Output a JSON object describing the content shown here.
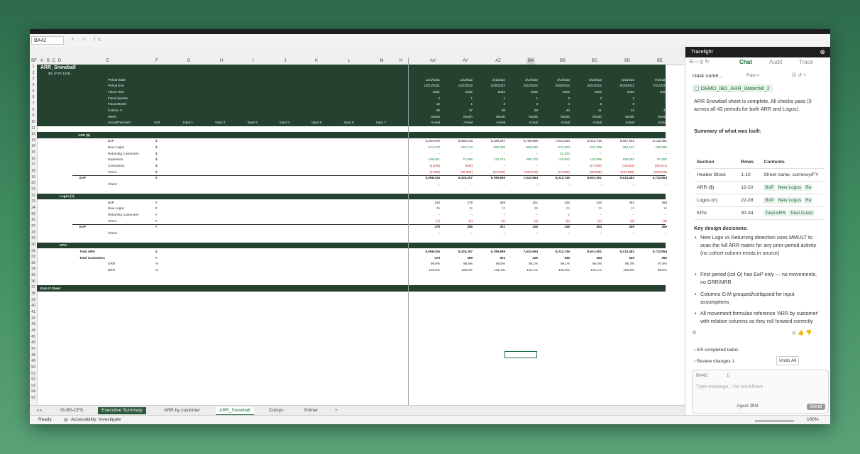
{
  "formula_bar": {
    "name_box": "BA42",
    "fx": "× ✓ fx"
  },
  "sheet": {
    "title": "ARR_Snowball",
    "subtitle": "$m | FYE 12/31",
    "columns": [
      "A",
      "B",
      "C",
      "D",
      "E",
      "F",
      "G",
      "H",
      "I",
      "J",
      "K",
      "L",
      "M",
      "N",
      "AX",
      "AY",
      "AZ",
      "BA",
      "BB",
      "BC",
      "BD",
      "BE",
      "BF"
    ],
    "header_labels": [
      "Period Start",
      "Period End",
      "Fiscal Year",
      "Fiscal Quarter",
      "Fiscal Month",
      "Column #",
      "Metric",
      "Actual/Forecast"
    ],
    "unit_header": "Unit",
    "inputs": [
      "Input 1",
      "Input 2",
      "Input 3",
      "Input 4",
      "Input 5",
      "Input 6",
      "Input 7"
    ],
    "periods": [
      {
        "start": "12/1/2021",
        "end": "12/31/2021",
        "fy": "2021",
        "fq": "4",
        "fm": "12",
        "col": "36",
        "metric": "Month",
        "af": "Actual"
      },
      {
        "start": "1/1/2022",
        "end": "1/31/2022",
        "fy": "2022",
        "fq": "1",
        "fm": "1",
        "col": "37",
        "metric": "Month",
        "af": "Actual"
      },
      {
        "start": "2/1/2022",
        "end": "2/28/2022",
        "fy": "2022",
        "fq": "1",
        "fm": "2",
        "col": "38",
        "metric": "Month",
        "af": "Actual"
      },
      {
        "start": "3/1/2022",
        "end": "3/31/2022",
        "fy": "2022",
        "fq": "1",
        "fm": "3",
        "col": "39",
        "metric": "Month",
        "af": "Actual"
      },
      {
        "start": "4/1/2022",
        "end": "4/30/2022",
        "fy": "2022",
        "fq": "2",
        "fm": "4",
        "col": "40",
        "metric": "Month",
        "af": "Actual"
      },
      {
        "start": "5/1/2022",
        "end": "5/31/2022",
        "fy": "2022",
        "fq": "2",
        "fm": "5",
        "col": "41",
        "metric": "Month",
        "af": "Actual"
      },
      {
        "start": "6/1/2022",
        "end": "6/30/2022",
        "fy": "2022",
        "fq": "2",
        "fm": "6",
        "col": "42",
        "metric": "Month",
        "af": "Actual"
      },
      {
        "start": "7/1/2022",
        "end": "7/31/2022",
        "fy": "2022",
        "fq": "3",
        "fm": "7",
        "col": "43",
        "metric": "Month",
        "af": "Actual"
      }
    ],
    "sections": {
      "arr": {
        "title": "ARR ($)",
        "rows": [
          {
            "label": "BoP",
            "unit": "$",
            "vals": [
              "5,264,676",
              "6,098,016",
              "6,329,297",
              "6,789,889",
              "7,543,664",
              "8,313,746",
              "8,647,601",
              "9,133,481"
            ],
            "cls": "d"
          },
          {
            "label": "New Logos",
            "unit": "$",
            "vals": [
              "674,473",
              "225,743",
              "380,330",
              "808,042",
              "674,254",
              "245,788",
              "459,187",
              "708,088"
            ],
            "cls": "g"
          },
          {
            "label": "Returning Customers",
            "unit": "$",
            "vals": [
              "–",
              "–",
              "–",
              "–",
              "23,200",
              "–",
              "–",
              "–"
            ],
            "cls": "g"
          },
          {
            "label": "Expansion",
            "unit": "$",
            "vals": [
              "169,821",
              "70,668",
              "113,742",
              "285,723",
              "149,837",
              "128,096",
              "189,802",
              "87,605"
            ],
            "cls": "g"
          },
          {
            "label": "Contraction",
            "unit": "$",
            "vals": [
              "(4,846)",
              "(608)",
              "–",
              "–",
              "–",
              "(17,089)",
              "(18,619)",
              "(65,021)"
            ],
            "cls": "r"
          },
          {
            "label": "Churn",
            "unit": "$",
            "vals": [
              "(6,488)",
              "(65,082)",
              "(33,500)",
              "(133,540)",
              "(73,289)",
              "(28,508)",
              "(132,898)",
              "(130,549)"
            ],
            "cls": "r"
          },
          {
            "label": "EoP",
            "unit": "$",
            "vals": [
              "6,098,016",
              "6,329,297",
              "6,789,889",
              "7,543,664",
              "8,313,746",
              "8,647,601",
              "9,133,481",
              "9,733,654"
            ],
            "cls": "d",
            "bold": true
          },
          {
            "label": "Check",
            "unit": "",
            "vals": [
              "–",
              "–",
              "–",
              "–",
              "–",
              "–",
              "–",
              "–"
            ],
            "cls": "d"
          }
        ]
      },
      "logos": {
        "title": "Logos (#)",
        "rows": [
          {
            "label": "BoP",
            "unit": "#",
            "vals": [
              "244",
              "279",
              "289",
              "301",
              "326",
              "345",
              "354",
              "359"
            ],
            "cls": "d"
          },
          {
            "label": "New Logos",
            "unit": "#",
            "vals": [
              "36",
              "16",
              "13",
              "28",
              "24",
              "13",
              "13",
              "16"
            ],
            "cls": "g"
          },
          {
            "label": "Returning Customers",
            "unit": "#",
            "vals": [
              "–",
              "–",
              "–",
              "–",
              "1",
              "–",
              "–",
              "–"
            ],
            "cls": "g"
          },
          {
            "label": "Churn",
            "unit": "#",
            "vals": [
              "(1)",
              "(6)",
              "(1)",
              "(4)",
              "(6)",
              "(4)",
              "(8)",
              "(5)"
            ],
            "cls": "r"
          },
          {
            "label": "EoP",
            "unit": "#",
            "vals": [
              "279",
              "289",
              "301",
              "326",
              "345",
              "354",
              "359",
              "369"
            ],
            "cls": "d",
            "bold": true
          },
          {
            "label": "Check",
            "unit": "",
            "vals": [
              "–",
              "–",
              "–",
              "–",
              "–",
              "–",
              "–",
              "–"
            ],
            "cls": "d"
          }
        ]
      },
      "kpis": {
        "title": "KPIs",
        "rows": [
          {
            "label": "Total ARR",
            "unit": "$",
            "vals": [
              "6,098,016",
              "6,329,297",
              "6,789,889",
              "7,543,664",
              "8,313,746",
              "8,647,601",
              "9,133,481",
              "9,733,654"
            ],
            "cls": "d",
            "bold": true
          },
          {
            "label": "Total Customers",
            "unit": "#",
            "vals": [
              "279",
              "289",
              "301",
              "326",
              "345",
              "354",
              "359",
              "369"
            ],
            "cls": "d",
            "bold": true
          },
          {
            "label": "GRR",
            "unit": "%",
            "vals": [
              "99.8%",
              "98.9%",
              "99.5%",
              "98.1%",
              "99.1%",
              "99.4%",
              "98.3%",
              "97.9%"
            ],
            "cls": "d"
          },
          {
            "label": "NRR",
            "unit": "%",
            "vals": [
              "103.0%",
              "100.0%",
              "101.4%",
              "102.1%",
              "101.0%",
              "101.1%",
              "100.9%",
              "99.5%"
            ],
            "cls": "d"
          }
        ]
      },
      "end": "End of Sheet"
    }
  },
  "tabs": [
    "IS-BS-CFS",
    "Executive Summary",
    "ARR by customer",
    "ARR_Snowball",
    "Comps",
    "Primer"
  ],
  "active_tab": "ARR_Snowball",
  "status": {
    "ready": "Ready",
    "accessibility": "Accessibility: Investigate",
    "zoom": "100%"
  },
  "panel": {
    "title": "Tracelight",
    "tabs": [
      "Chat",
      "Audit",
      "Trace"
    ],
    "task_name": "<task name...",
    "raw_label": "Raw",
    "file_chip": "DEMO_IBD_ARR_Waterfall_2",
    "intro": "ARR Snowball sheet is complete. All checks pass (0 across all 43 periods for both ARR and Logos).",
    "summary_heading": "Summary of what was built:",
    "table": {
      "headers": [
        "Section",
        "Rows",
        "Contents"
      ],
      "rows": [
        {
          "section": "Header Block",
          "rows": "1-10",
          "contents": "Sheet name, currency/FY"
        },
        {
          "section": "ARR ($)",
          "rows": "12-20",
          "chips": [
            "BoP",
            "New Logos",
            "Re"
          ]
        },
        {
          "section": "Logos (#)",
          "rows": "22-28",
          "chips": [
            "BoP",
            "New Logos",
            "Re"
          ]
        },
        {
          "section": "KPIs",
          "rows": "30-34",
          "chips": [
            "Total ARR",
            "Total Custo"
          ]
        }
      ]
    },
    "design_heading": "Key design decisions:",
    "bullets": [
      "New Logo vs Returning detection uses MMULT to scan the full ARR matrix for any prior-period activity (no cohort column exists in source)",
      "First period (col O) has EoP only — no movements, no GRR/NRR",
      "Columns G:M grouped/collapsed for input assumptions",
      "All movement formulas reference 'ARR by customer' with relative columns so they roll forward correctly"
    ],
    "todos": "5/5 completed todos",
    "review": "Review changes 1",
    "undo": "Undo All",
    "composer_ref": "BA42",
    "composer_count": "1",
    "placeholder": "Type message, / for workflows",
    "agent": "Agent ⌘M",
    "send": "Send"
  }
}
